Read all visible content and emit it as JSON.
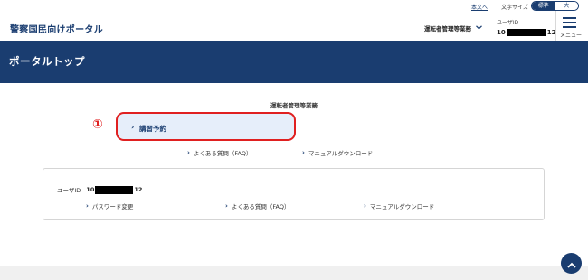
{
  "utility": {
    "main_text_link": "本文へ",
    "font_size_label": "文字サイズ",
    "font_size_options": [
      "標準",
      "大"
    ],
    "font_size_selected": "標準"
  },
  "header": {
    "site_title": "警察国民向けポータル",
    "department": "運転者管理等業務",
    "user_id_label": "ユーザID",
    "user_id_prefix": "10",
    "user_id_suffix": "12",
    "menu_label": "メニュー"
  },
  "banner": {
    "title": "ポータルトップ"
  },
  "main": {
    "section_heading": "運転者管理等業務",
    "annotation_number": "①",
    "primary_button_label": "講習予約",
    "links": [
      "よくある質問（FAQ）",
      "マニュアルダウンロード"
    ]
  },
  "card": {
    "user_id_label": "ユーザID",
    "user_id_prefix": "10",
    "user_id_suffix": "12",
    "links": [
      "パスワード変更",
      "よくある質問（FAQ）",
      "マニュアルダウンロード"
    ]
  },
  "colors": {
    "brand_navy": "#1a3d70",
    "highlight_red": "#e02020",
    "button_bg": "#e6eefa"
  },
  "icons": {
    "chevron": "chevron-right-icon",
    "dept_dropdown": "chevron-down-icon",
    "menu": "hamburger-icon",
    "page_top": "arrow-up-icon"
  }
}
